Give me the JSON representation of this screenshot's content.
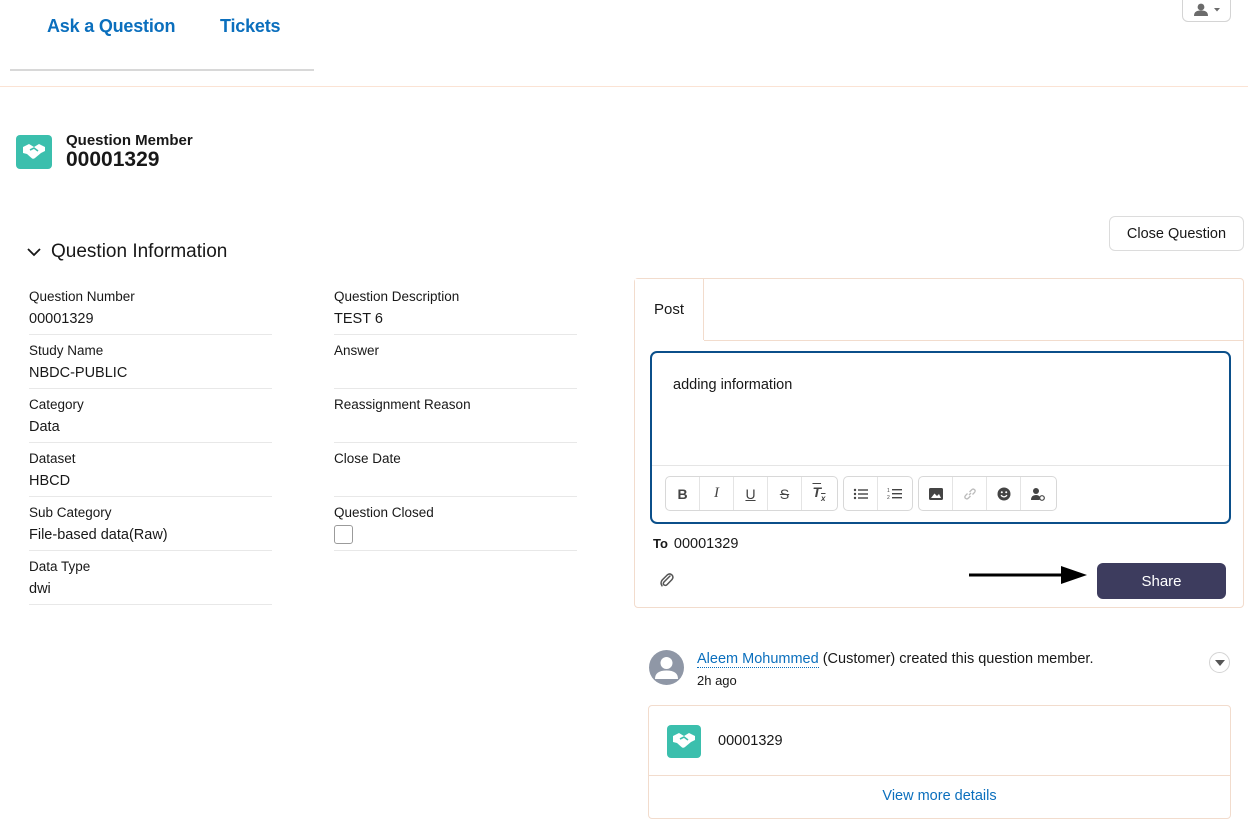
{
  "nav": {
    "ask_question": "Ask a Question",
    "tickets": "Tickets"
  },
  "record": {
    "type_label": "Question Member",
    "number": "00001329",
    "icon": "handshake-icon"
  },
  "section": {
    "title": "Question Information"
  },
  "fields_left": [
    {
      "label": "Question Number",
      "value": "00001329"
    },
    {
      "label": "Study Name",
      "value": "NBDC-PUBLIC"
    },
    {
      "label": "Category",
      "value": "Data"
    },
    {
      "label": "Dataset",
      "value": "HBCD"
    },
    {
      "label": "Sub Category",
      "value": "File-based data(Raw)"
    },
    {
      "label": "Data Type",
      "value": "dwi"
    }
  ],
  "fields_right": [
    {
      "label": "Question Description",
      "value": "TEST 6"
    },
    {
      "label": "Answer",
      "value": ""
    },
    {
      "label": "Reassignment Reason",
      "value": ""
    },
    {
      "label": "Close Date",
      "value": ""
    },
    {
      "label": "Question Closed",
      "checked": false
    }
  ],
  "actions": {
    "close_question": "Close Question"
  },
  "publisher": {
    "tab_post": "Post",
    "body_text": "adding information",
    "to_label": "To",
    "to_value": "00001329",
    "share_label": "Share",
    "toolbar_groups": [
      [
        "bold-icon",
        "italic-icon",
        "underline-icon",
        "strikethrough-icon",
        "clear-format-icon"
      ],
      [
        "bulleted-list-icon",
        "numbered-list-icon"
      ],
      [
        "image-icon",
        "link-icon",
        "emoji-icon",
        "mention-icon"
      ]
    ]
  },
  "feed": {
    "author": "Aleem Mohummed",
    "action_text": " (Customer) created this question member.",
    "time": "2h ago",
    "card_number": "00001329",
    "view_more": "View more details"
  },
  "colors": {
    "link": "#0b6fbd",
    "record_icon": "#3bbfad",
    "share_button": "#3d3c5e",
    "composer_border": "#0b4f8a"
  }
}
